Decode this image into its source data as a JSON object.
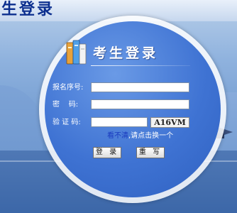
{
  "page": {
    "corner_title": "生登录"
  },
  "dialog": {
    "title": "考生登录",
    "fields": {
      "registration_label": "报名序号:",
      "registration_value": "",
      "password_label": "密    码:",
      "password_value": "",
      "captcha_label": "验 证 码:",
      "captcha_value": "",
      "captcha_code": "A16VM"
    },
    "hint": {
      "link": "看不清",
      "text": ",请点击换一个"
    },
    "buttons": {
      "login": "登 录",
      "reset": "重 写"
    }
  },
  "colors": {
    "disc_blue": "#3f73d3",
    "title_blue": "#0c2f8f",
    "link_blue": "#1a3bbf"
  },
  "icons": {
    "book": "book-stack-icon",
    "cap": "graduation-cap-icon"
  }
}
